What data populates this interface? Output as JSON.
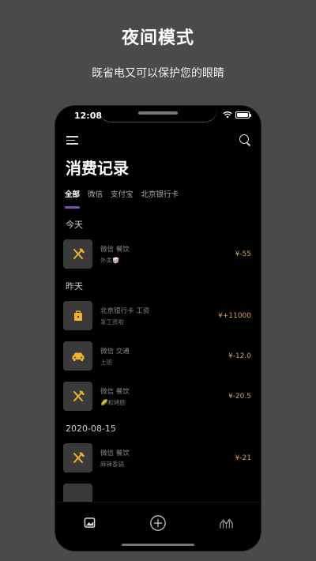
{
  "promo": {
    "title": "夜间模式",
    "subtitle": "既省电又可以保护您的眼睛"
  },
  "status_bar": {
    "time": "12:08"
  },
  "header": {
    "title": "消费记录"
  },
  "tabs": [
    {
      "label": "全部",
      "active": true
    },
    {
      "label": "微信",
      "active": false
    },
    {
      "label": "支付宝",
      "active": false
    },
    {
      "label": "北京银行卡",
      "active": false
    }
  ],
  "sections": [
    {
      "date": "今天",
      "items": [
        {
          "icon": "utensils-icon",
          "category": "微信 餐饮",
          "note": "外卖🥡",
          "amount": "¥-55"
        }
      ]
    },
    {
      "date": "昨天",
      "items": [
        {
          "icon": "briefcase-icon",
          "category": "北京银行卡 工资",
          "note": "发工资啦",
          "amount": "¥+11000"
        },
        {
          "icon": "car-icon",
          "category": "微信 交通",
          "note": "上班",
          "amount": "¥-12.0"
        },
        {
          "icon": "utensils-icon",
          "category": "微信 餐饮",
          "note": "🌽和烤肠",
          "amount": "¥-20.5"
        }
      ]
    },
    {
      "date": "2020-08-15",
      "items": [
        {
          "icon": "utensils-icon",
          "category": "微信 餐饮",
          "note": "麻辣香锅",
          "amount": "¥-21"
        }
      ]
    }
  ],
  "colors": {
    "accent": "#7c4dbf",
    "amount": "#d4a26a",
    "icon": "#f0b429"
  }
}
